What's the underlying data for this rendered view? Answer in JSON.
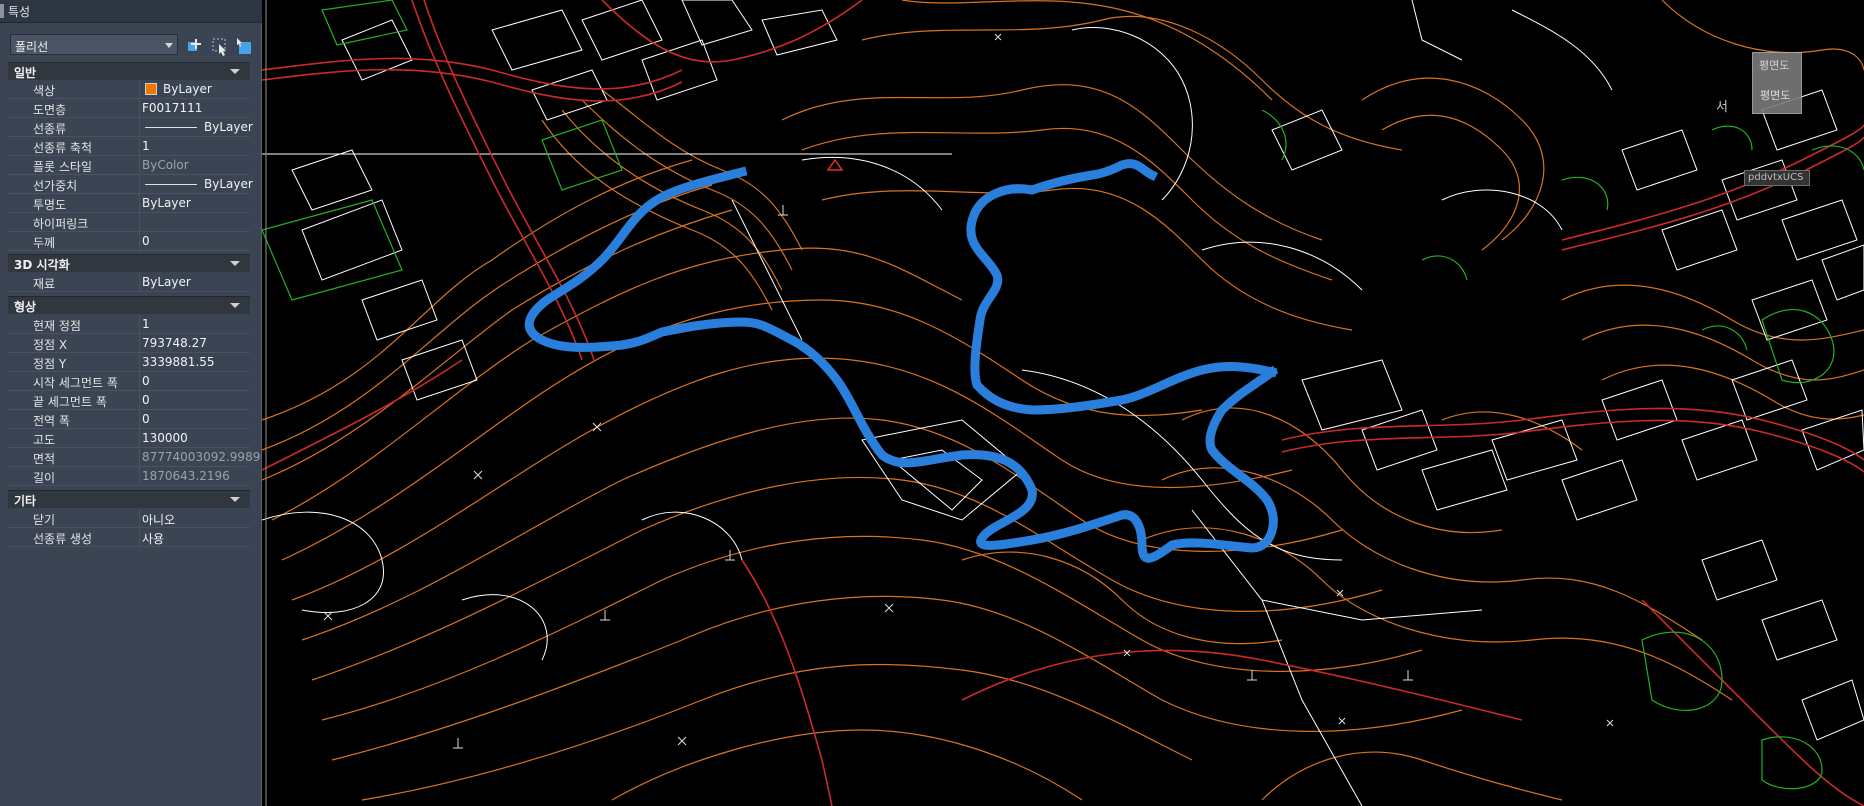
{
  "palette": {
    "title": "특성",
    "object_type": "폴리선",
    "sections": {
      "general": "일반",
      "viz3d": "3D 시각화",
      "geometry": "형상",
      "misc": "기타"
    },
    "general": {
      "color_label": "색상",
      "color_value": "ByLayer",
      "color_swatch": "#f07800",
      "layer_label": "도면층",
      "layer_value": "F0017111",
      "linetype_label": "선종류",
      "linetype_value": "ByLayer",
      "ltscale_label": "선종류 축척",
      "ltscale_value": "1",
      "plotstyle_label": "플롯 스타일",
      "plotstyle_value": "ByColor",
      "lineweight_label": "선가중치",
      "lineweight_value": "ByLayer",
      "transparency_label": "투명도",
      "transparency_value": "ByLayer",
      "hyperlink_label": "하이퍼링크",
      "hyperlink_value": "",
      "thickness_label": "두께",
      "thickness_value": "0"
    },
    "viz3d": {
      "material_label": "재료",
      "material_value": "ByLayer"
    },
    "geometry": {
      "vertex_label": "현재 정점",
      "vertex_value": "1",
      "vx_label": "정점 X",
      "vx_value": "793748.27",
      "vy_label": "정점 Y",
      "vy_value": "3339881.55",
      "startw_label": "시작 세그먼트 폭",
      "startw_value": "0",
      "endw_label": "끝 세그먼트 폭",
      "endw_value": "0",
      "globalw_label": "전역 폭",
      "globalw_value": "0",
      "elev_label": "고도",
      "elev_value": "130000",
      "area_label": "면적",
      "area_value": "87774003092.9989",
      "length_label": "길이",
      "length_value": "1870643.2196"
    },
    "misc": {
      "closed_label": "닫기",
      "closed_value": "아니오",
      "ltgen_label": "선종류 생성",
      "ltgen_value": "사용"
    }
  },
  "viewport": {
    "viewcube_top": "평면도",
    "viewcube_face": "평면도",
    "compass_letter": "서",
    "wcs_label": "pddvtxUCS"
  },
  "colors": {
    "contour": "#d8731f",
    "building": "#ffffff",
    "road": "#cc2a2a",
    "vegetation": "#22b022",
    "selected_polyline": "#2a7fdc"
  }
}
